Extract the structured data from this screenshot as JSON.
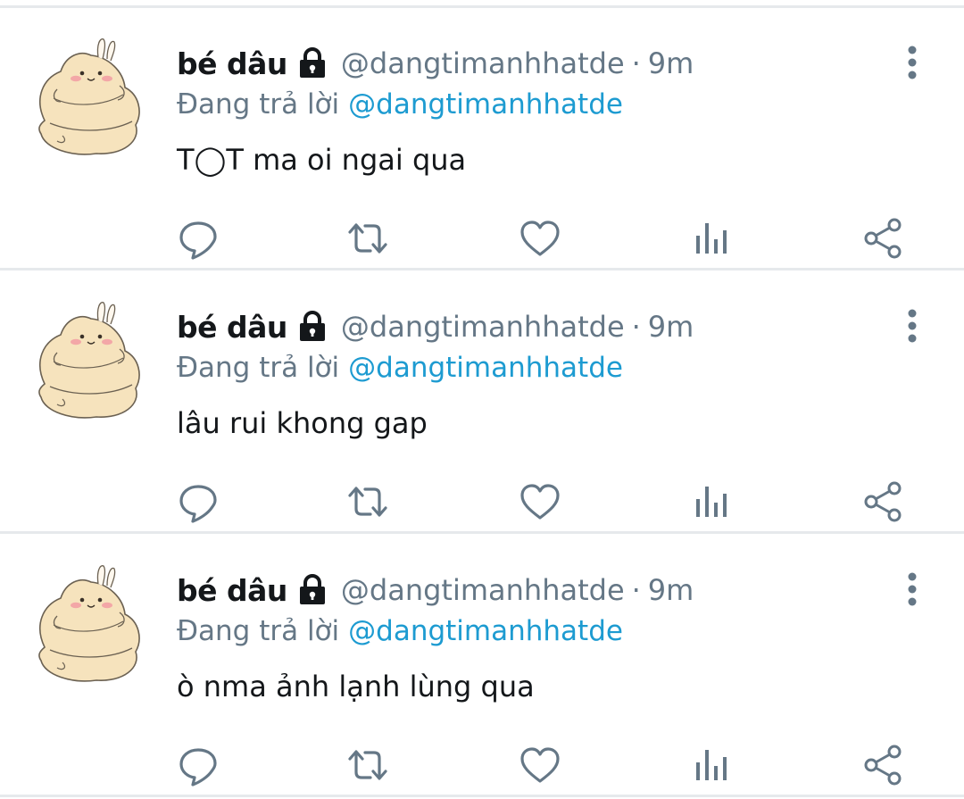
{
  "colors": {
    "text": "#14171a",
    "secondary": "#657786",
    "accent": "#1d9bd1",
    "divider": "#e6e9ec",
    "icon": "#657786"
  },
  "icons": {
    "lock": "lock-icon",
    "more": "more-vertical-icon",
    "reply": "reply-icon",
    "retweet": "retweet-icon",
    "like": "heart-icon",
    "analytics": "analytics-icon",
    "share": "share-icon"
  },
  "tweets": [
    {
      "name": "bé dâu",
      "handle": "@dangtimanhhatde",
      "dot": "·",
      "time": "9m",
      "reply_prefix": "Đang trả lời",
      "reply_to": "@dangtimanhhatde",
      "text": "T◯T ma oi ngai qua"
    },
    {
      "name": "bé dâu",
      "handle": "@dangtimanhhatde",
      "dot": "·",
      "time": "9m",
      "reply_prefix": "Đang trả lời",
      "reply_to": "@dangtimanhhatde",
      "text": "lâu rui khong gap"
    },
    {
      "name": "bé dâu",
      "handle": "@dangtimanhhatde",
      "dot": "·",
      "time": "9m",
      "reply_prefix": "Đang trả lời",
      "reply_to": "@dangtimanhhatde",
      "text": "ò nma ảnh lạnh lùng qua"
    }
  ]
}
